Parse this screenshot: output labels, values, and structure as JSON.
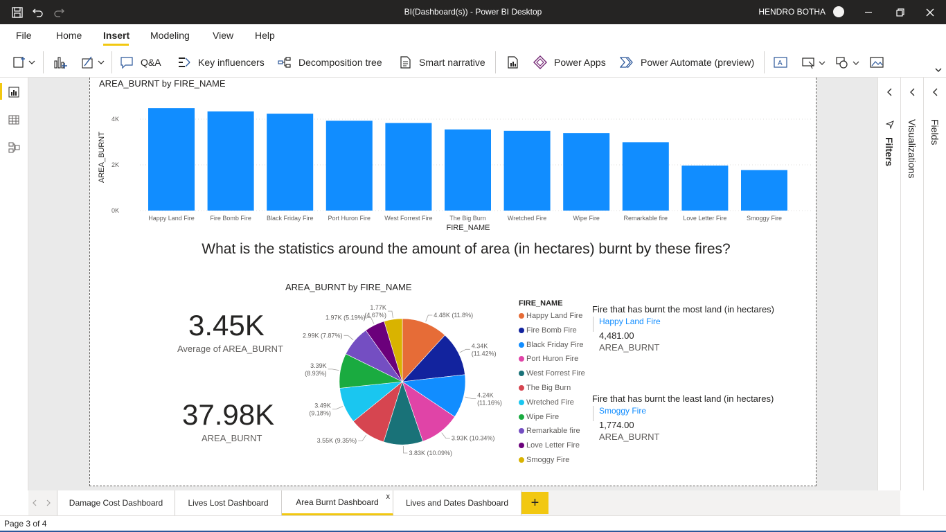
{
  "window": {
    "title": "BI(Dashboard(s)) - Power BI Desktop",
    "user": "HENDRO BOTHA"
  },
  "menu": [
    "File",
    "Home",
    "Insert",
    "Modeling",
    "View",
    "Help"
  ],
  "menu_active": "Insert",
  "ribbon": {
    "qa": "Q&A",
    "key_influencers": "Key influencers",
    "decomposition_tree": "Decomposition tree",
    "smart_narrative": "Smart narrative",
    "power_apps": "Power Apps",
    "power_automate": "Power Automate (preview)"
  },
  "panes": {
    "filters": "Filters",
    "visualizations": "Visualizations",
    "fields": "Fields"
  },
  "bar_chart": {
    "title": "AREA_BURNT by FIRE_NAME",
    "xlabel": "FIRE_NAME",
    "ylabel": "AREA_BURNT",
    "ticks": [
      "0K",
      "2K",
      "4K"
    ]
  },
  "question": "What is the statistics around the amount of area (in hectares) burnt by these fires?",
  "cards": [
    {
      "value": "3.45K",
      "label": "Average of AREA_BURNT"
    },
    {
      "value": "37.98K",
      "label": "AREA_BURNT"
    }
  ],
  "pie_chart": {
    "title": "AREA_BURNT by FIRE_NAME",
    "legend_title": "FIRE_NAME",
    "labels": [
      "4.48K (11.8%)",
      [
        "4.34K",
        "(11.42%)"
      ],
      [
        "4.24K",
        "(11.16%)"
      ],
      "3.93K (10.34%)",
      "3.83K (10.09%)",
      "3.55K (9.35%)",
      [
        "3.49K",
        "(9.18%)"
      ],
      [
        "3.39K",
        "(8.93%)"
      ],
      "2.99K (7.87%)",
      "1.97K (5.19%)",
      [
        "1.77K",
        "(4.67%)"
      ]
    ]
  },
  "chart_data": [
    {
      "type": "bar",
      "title": "AREA_BURNT by FIRE_NAME",
      "xlabel": "FIRE_NAME",
      "ylabel": "AREA_BURNT",
      "categories": [
        "Happy Land Fire",
        "Fire Bomb Fire",
        "Black Friday Fire",
        "Port Huron Fire",
        "West Forrest Fire",
        "The Big Burn",
        "Wretched Fire",
        "Wipe Fire",
        "Remarkable fire",
        "Love Letter Fire",
        "Smoggy Fire"
      ],
      "values": [
        4481,
        4340,
        4240,
        3930,
        3830,
        3550,
        3490,
        3390,
        2990,
        1970,
        1774
      ],
      "ylim": [
        0,
        4500
      ],
      "grid": true,
      "color": "#118DFF"
    },
    {
      "type": "pie",
      "title": "AREA_BURNT by FIRE_NAME",
      "categories": [
        "Happy Land Fire",
        "Fire Bomb Fire",
        "Black Friday Fire",
        "Port Huron Fire",
        "West Forrest Fire",
        "The Big Burn",
        "Wretched Fire",
        "Wipe Fire",
        "Remarkable fire",
        "Love Letter Fire",
        "Smoggy Fire"
      ],
      "values": [
        4481,
        4340,
        4240,
        3930,
        3830,
        3550,
        3490,
        3390,
        2990,
        1970,
        1774
      ],
      "colors": [
        "#E66C37",
        "#12239E",
        "#118DFF",
        "#E044A7",
        "#197278",
        "#D64550",
        "#1AC6F0",
        "#1AAB40",
        "#744EC2",
        "#6B007B",
        "#D9B300"
      ],
      "legend": "right"
    }
  ],
  "multirow": [
    {
      "title": "Fire that has burnt the most land (in hectares)",
      "name": "Happy Land Fire",
      "value": "4,481.00",
      "field": "AREA_BURNT"
    },
    {
      "title": "Fire that has burnt the least land (in hectares)",
      "name": "Smoggy Fire",
      "value": "1,774.00",
      "field": "AREA_BURNT"
    }
  ],
  "tabs": [
    "Damage Cost Dashboard",
    "Lives Lost Dashboard",
    "Area Burnt Dashboard",
    "Lives and Dates Dashboard"
  ],
  "tab_active": "Area Burnt Dashboard",
  "tab_close": "x",
  "tab_add": "+",
  "status": "Page 3 of 4"
}
